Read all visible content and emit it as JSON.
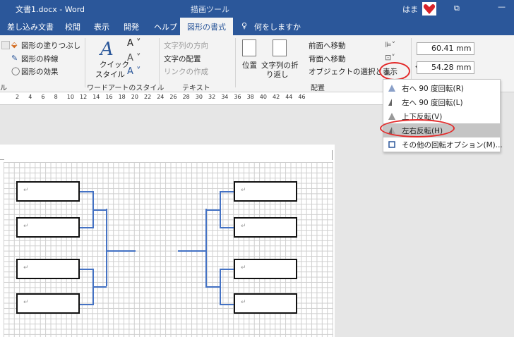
{
  "window": {
    "doc_title": "文書1.docx  -  Word",
    "context_label": "描画ツール",
    "user": "はま",
    "restore_glyph": "⧉",
    "minimize_glyph": "—"
  },
  "tabs": [
    "差し込み文書",
    "校閲",
    "表示",
    "開発",
    "ヘルプ",
    "図形の書式",
    "何をしますか"
  ],
  "ribbon": {
    "shape_styles": {
      "fill": "図形の塗りつぶし",
      "outline": "図形の枠線",
      "effects": "図形の効果",
      "label_fragment": "ル"
    },
    "wordart": {
      "quick_styles_1": "クイック",
      "quick_styles_2": "スタイル",
      "label": "ワードアートのスタイル"
    },
    "text": {
      "direction": "文字列の方向",
      "align": "文字の配置",
      "link": "リンクの作成",
      "label": "テキスト"
    },
    "arrange": {
      "position": "位置",
      "wrap_1": "文字列の折",
      "wrap_2": "り返し",
      "bring_forward": "前面へ移動",
      "send_backward": "背面へ移動",
      "selection_pane": "オブジェクトの選択と表示",
      "label": "配置"
    },
    "size": {
      "height": "60.41 mm",
      "width": "54.28 mm"
    }
  },
  "ruler_ticks": [
    "2",
    "4",
    "6",
    "8",
    "10",
    "12",
    "14",
    "16",
    "18",
    "20",
    "22",
    "24",
    "26",
    "28",
    "30",
    "32",
    "34",
    "36",
    "38",
    "40",
    "42",
    "44",
    "46"
  ],
  "rotate_menu": {
    "items": [
      {
        "label": "右へ 90 度回転(R)",
        "enabled": true
      },
      {
        "label": "左へ 90 度回転(L)",
        "enabled": true
      },
      {
        "label": "上下反転(V)",
        "enabled": true
      },
      {
        "label": "左右反転(H)",
        "enabled": true,
        "highlighted": true
      },
      {
        "label": "その他の回転オプション(M)...",
        "enabled": true
      }
    ]
  },
  "doc": {
    "para_mark": "↵"
  },
  "colors": {
    "title_bar": "#2b579a",
    "connector": "#4472c4",
    "highlight_oval": "#e32b2b"
  }
}
